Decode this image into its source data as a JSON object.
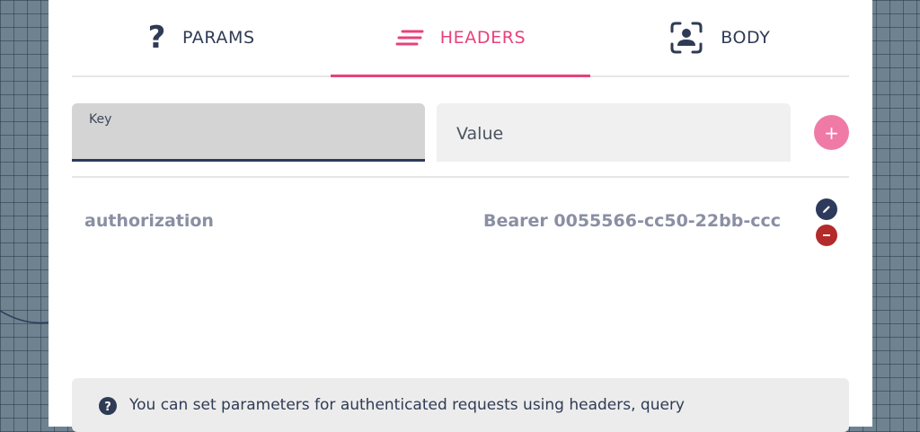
{
  "tabs": [
    {
      "label": "PARAMS",
      "icon": "question-icon",
      "active": false
    },
    {
      "label": "HEADERS",
      "icon": "lines-icon",
      "active": true
    },
    {
      "label": "BODY",
      "icon": "user-focus-icon",
      "active": false
    }
  ],
  "form": {
    "key_label": "Key",
    "key_value": "",
    "value_placeholder": "Value",
    "add_icon": "plus-icon"
  },
  "headers_list": [
    {
      "key": "authorization",
      "value": "Bearer 0055566-cc50-22bb-ccc"
    }
  ],
  "info": {
    "icon": "question-circle-icon",
    "text": "You can set parameters for authenticated requests using headers, query"
  },
  "colors": {
    "accent": "#e8417b",
    "navy": "#2d3a5c",
    "danger": "#b52a2a",
    "add_button": "#f07aa6"
  }
}
